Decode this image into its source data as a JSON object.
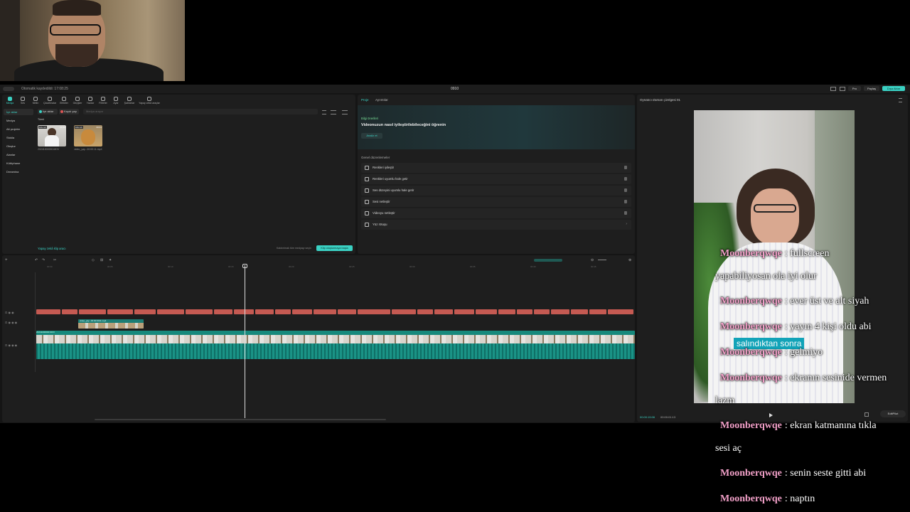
{
  "titlebar": {
    "left_text": "Otomatik kaydedildi: 17:08:25",
    "center_text": "0910",
    "pro_label": "Pro",
    "share_label": "Paylaş",
    "export_label": "Dışa Aktar"
  },
  "media": {
    "toolbar": [
      "Medya",
      "Ses",
      "Metin",
      "Çıkartmalar",
      "Efektler",
      "Geçişler",
      "Yazılar",
      "Filtreler",
      "Ayar",
      "Şablonlar",
      "Yapay zekâ araçlar"
    ],
    "sidebar": [
      "İçe aktar",
      "Medya",
      "Alt projeler",
      "Stokla",
      "Oluştur",
      "Alanlar",
      "Kütüphane",
      "Dreamina"
    ],
    "import_button": "İçe aktar",
    "record_button": "Kaydı yap",
    "search_placeholder": "Medya arayın",
    "all_label": "Tümü",
    "clips": [
      {
        "badge": "Eklendi",
        "duration": "00:14",
        "name": "20241000000.MOV"
      },
      {
        "badge": "Eklendi",
        "duration": "00:01",
        "name": "video_yay...00:00:11.mp4"
      }
    ],
    "ai_link": "Yapay zekâ klip aracı",
    "bottom_note": "Kaldırılmak tüm medyayı seçin",
    "bottom_button": "Klip oluşturmaya başla"
  },
  "props": {
    "tabs": [
      "Proje",
      "Ayrıntılar"
    ],
    "tips_label": "Bilgi önerileri",
    "tip_title": "Videonuzun nasıl iyileştirilebileceğini öğrenin",
    "analyze_button": "Analiz et",
    "section_title": "Genel düzenlemeler",
    "options": [
      "Renkleri iyileştir",
      "Renkleri uyumlu hale getir",
      "Ses düzeyini uyumlu hale getir",
      "Sesi netleştir",
      "Videoyu netleştir",
      "Yüz rötuşu"
    ]
  },
  "player": {
    "title": "Oynatıcı-Zaman çizelgesi 01",
    "caption": "salındıktan sonra",
    "time_current": "00:00:15:06",
    "time_total": "00:00:01:13",
    "editpilot_label": "EditPilot"
  },
  "timeline": {
    "ruler": [
      "00:00",
      "00:05",
      "00:10",
      "00:15",
      "00:20",
      "00:25",
      "00:30",
      "00:35",
      "00:40",
      "00:45",
      "00:50"
    ],
    "overlay_clip": "video_yay...00:00:0011.mp4",
    "track_clip": "20241000000.MOV"
  },
  "chat": [
    {
      "user": "Moonberqwqe",
      "msg": ": fullscreen",
      "cont": "yapabiliyosan ola iyi olur"
    },
    {
      "user": "Moonberqwqe",
      "msg": ": ever üst ve alt siyah",
      "cont": ""
    },
    {
      "user": "Moonberqwqe",
      "msg": ": yayın 4 kişi oldu abi",
      "cont": ""
    },
    {
      "user": "Moonberqwqe",
      "msg": ": gelmiyo",
      "cont": ""
    },
    {
      "user": "Moonberqwqe",
      "msg": ": ekranın sesinide vermen",
      "cont": "lazm"
    },
    {
      "user": "Moonberqwqe",
      "msg": ": ekran katmanına tıkla",
      "cont": "sesi aç"
    },
    {
      "user": "Moonberqwqe",
      "msg": ": senin seste gitti abi",
      "cont": ""
    },
    {
      "user": "Moonberqwqe",
      "msg": ": naptın",
      "cont": ""
    }
  ],
  "colors": {
    "accent": "#3ad1c3",
    "clip_red": "#c55a52",
    "track_teal": "#17897c",
    "chat_user": "#f2a0c8"
  }
}
